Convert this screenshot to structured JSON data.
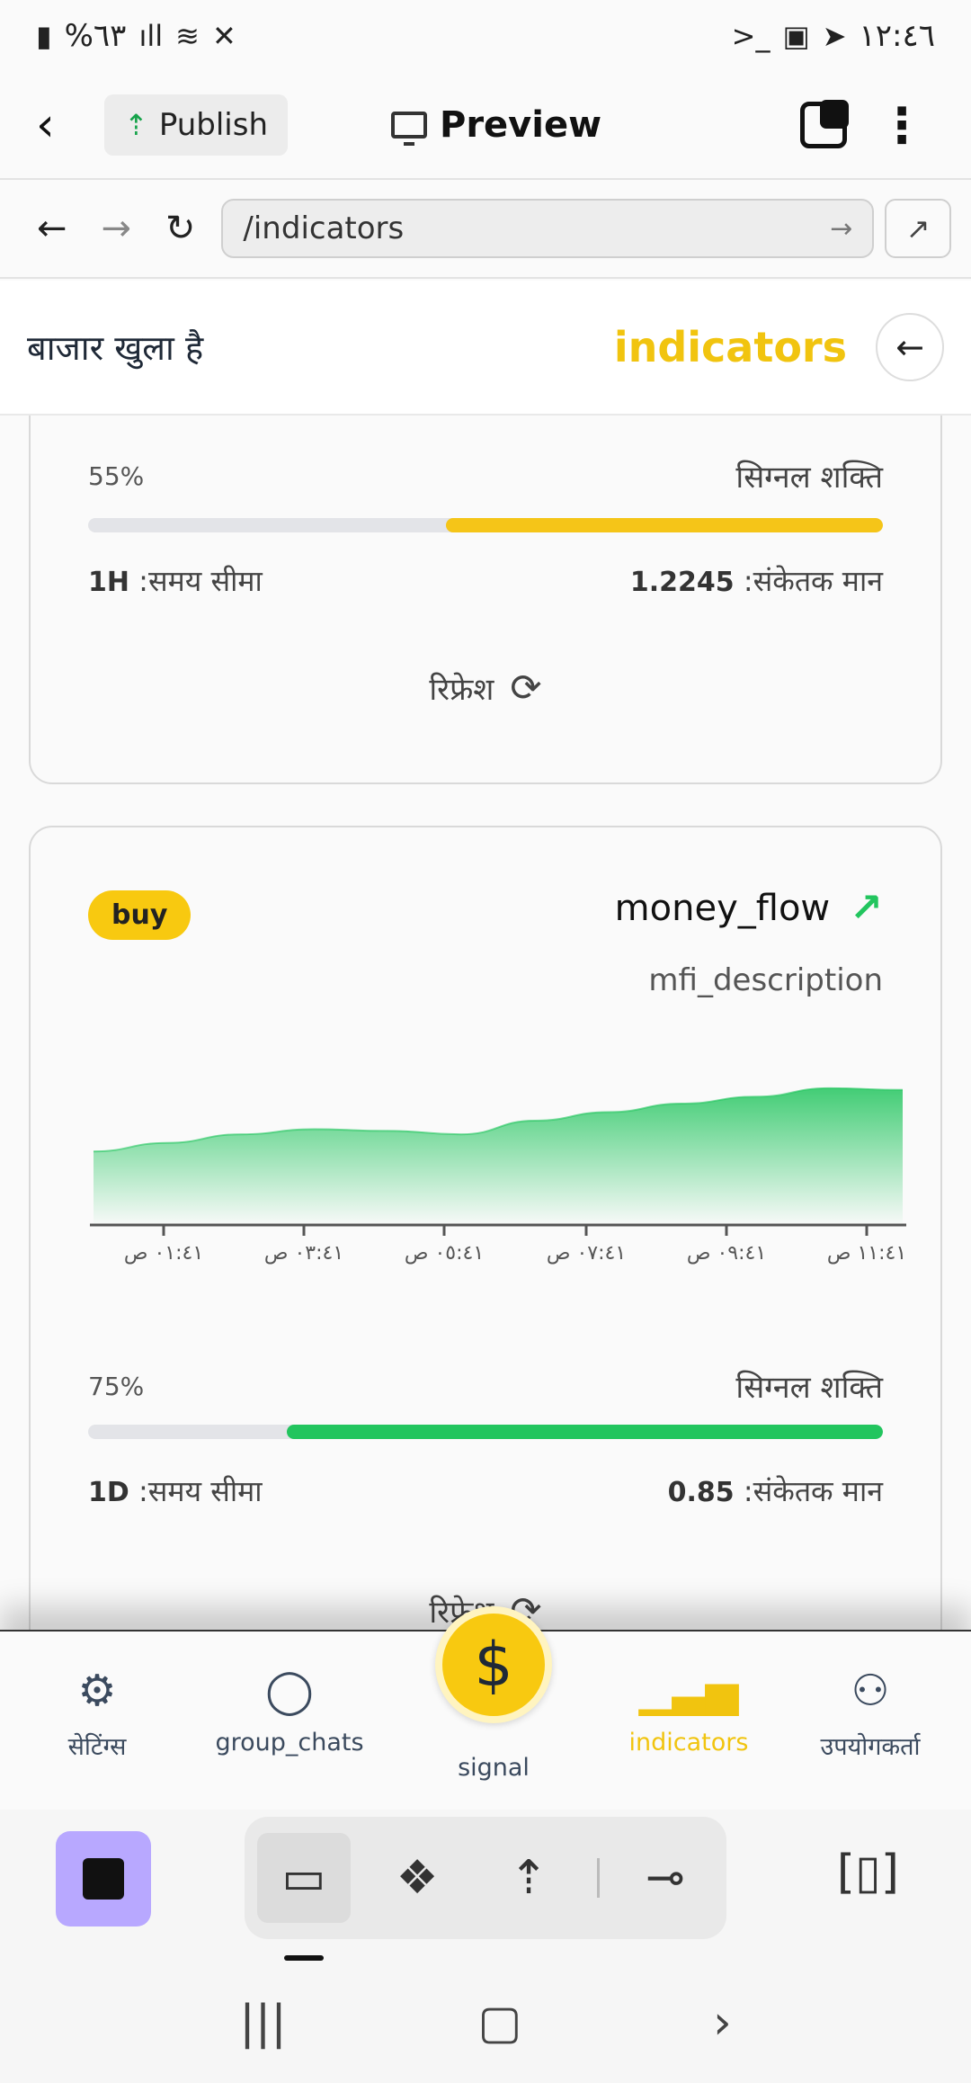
{
  "status_bar": {
    "battery": "%٦٣",
    "time": "١٢:٤٦"
  },
  "app_bar": {
    "publish_label": "Publish",
    "preview_label": "Preview"
  },
  "browser": {
    "url": "/indicators"
  },
  "header": {
    "market_status": "बाजार खुला है",
    "title": "indicators"
  },
  "card1": {
    "signal_strength_pct": "55%",
    "signal_strength_value": 0.55,
    "signal_strength_label": "सिग्नल शक्ति",
    "bar_color": "#f5c518",
    "timeframe_label": ":समय सीमा",
    "timeframe_value": "1H",
    "indicator_value_label": ":संकेतक मान",
    "indicator_value": "1.2245",
    "refresh_label": "रिफ्रेश"
  },
  "card2": {
    "signal_badge": "buy",
    "title": "money_flow",
    "description": "mfi_description",
    "signal_strength_pct": "75%",
    "signal_strength_value": 0.75,
    "signal_strength_label": "सिग्नल शक्ति",
    "bar_color": "#22c55e",
    "timeframe_label": ":समय सीमा",
    "timeframe_value": "1D",
    "indicator_value_label": ":संकेतक मान",
    "indicator_value": "0.85",
    "refresh_label": "रिफ्रेश"
  },
  "chart_data": {
    "type": "area",
    "x": [
      "٠١:٤١ ص",
      "٠٣:٤١ ص",
      "٠٥:٤١ ص",
      "٠٧:٤١ ص",
      "٠٩:٤١ ص",
      "١١:٤١ ص"
    ],
    "tick_labels": [
      "٠١:٤١ ص",
      "٠٣:٤١ ص",
      "٠٥:٤١ ص",
      "٠٧:٤١ ص",
      "٠٩:٤١ ص",
      "١١:٤١ ص"
    ],
    "series": [
      {
        "values": [
          42,
          47,
          52,
          55,
          54,
          52,
          60,
          65,
          70,
          74,
          79,
          78
        ]
      }
    ],
    "ylim": [
      0,
      100
    ],
    "color": "#22c55e",
    "grid": false
  },
  "bottom_nav": {
    "items": [
      {
        "label": "सेटिंग्स",
        "icon": "gear-icon"
      },
      {
        "label": "group_chats",
        "icon": "chat-bubble-icon"
      },
      {
        "label": "indicators",
        "icon": "bar-chart-icon"
      },
      {
        "label": "उपयोगकर्ता",
        "icon": "users-icon"
      }
    ],
    "signal_label": "signal",
    "signal_symbol": "$",
    "active_color": "#f1c40f"
  }
}
